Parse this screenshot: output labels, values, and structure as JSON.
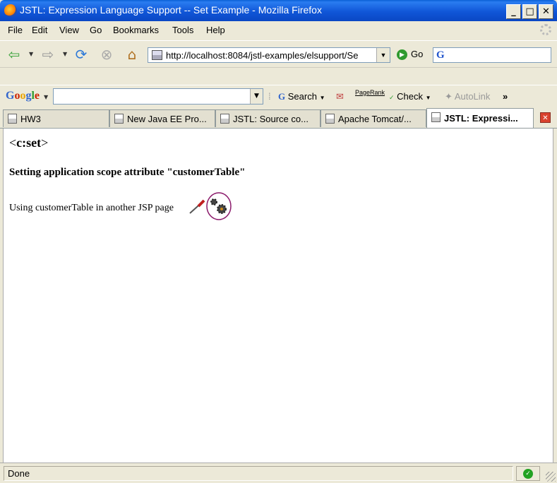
{
  "window": {
    "title": "JSTL: Expression Language Support -- Set Example - Mozilla Firefox",
    "minimize": "_",
    "maximize": "□",
    "close": "✕"
  },
  "menu": [
    "File",
    "Edit",
    "View",
    "Go",
    "Bookmarks",
    "Tools",
    "Help"
  ],
  "nav": {
    "url": "http://localhost:8084/jstl-examples/elsupport/Se",
    "go_label": "Go",
    "search_engine": "G"
  },
  "google_toolbar": {
    "logo": "Google",
    "search_label": "Search",
    "pagerank_label": "PageRank",
    "check_label": "Check",
    "autolink_label": "AutoLink",
    "more": "»"
  },
  "tabs": [
    {
      "label": "HW3",
      "active": false
    },
    {
      "label": "New Java EE Pro...",
      "active": false
    },
    {
      "label": "JSTL: Source co...",
      "active": false
    },
    {
      "label": "Apache Tomcat/...",
      "active": false
    },
    {
      "label": "JSTL: Expressi...",
      "active": true
    }
  ],
  "page": {
    "heading_open": "<",
    "heading_tag": "c:set",
    "heading_close": ">",
    "subheading": "Setting application scope attribute \"customerTable\"",
    "usage_text": "Using customerTable in another JSP page"
  },
  "status": {
    "text": "Done"
  },
  "colors": {
    "titlebar": "#0a47c4",
    "chrome": "#ece9d8",
    "link_circle": "#8b1a6b"
  }
}
